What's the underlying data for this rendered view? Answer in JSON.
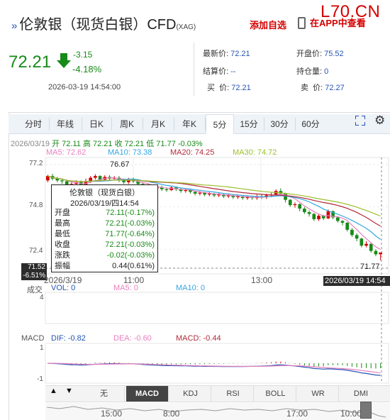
{
  "header": {
    "title": "伦敦银（现货白银）CFD",
    "title_sub": "(XAG)",
    "watermark": "L70.CN",
    "add_favorite": "添加自选",
    "app_link": "在APP中查看"
  },
  "quote": {
    "price": "72.21",
    "change": "-3.15",
    "change_pct": "-4.18%",
    "time": "2026-03-19 14:54:00",
    "stats": [
      {
        "label": "最新价:",
        "value": "72.21"
      },
      {
        "label": "开盘价:",
        "value": "75.52"
      },
      {
        "label": "结算价:",
        "value": "--"
      },
      {
        "label": "持仓量:",
        "value": "0"
      },
      {
        "label": "买  价:",
        "value": "72.21"
      },
      {
        "label": "卖  价:",
        "value": "72.27"
      }
    ]
  },
  "tabs": [
    "分时",
    "年线",
    "日K",
    "周K",
    "月K",
    "年K",
    "5分",
    "15分",
    "30分",
    "60分"
  ],
  "active_tab": "5分",
  "ohlc_line": {
    "date": "2026/03/19",
    "text": "开 72.11 高 72.21 收 72.21 低 71.77 -0.03%"
  },
  "ma": {
    "ma5": "MA5: 72.62",
    "ma10": "MA10: 73.38",
    "ma20": "MA20: 74.25",
    "ma30": "MA30: 74.72"
  },
  "colors": {
    "ma5": "#e87fbf",
    "ma10": "#35a7e0",
    "ma20": "#b02a3a",
    "ma30": "#9cbf2d",
    "down": "#188a18",
    "up": "#d40000"
  },
  "y_axis": [
    "77.2",
    "74.8",
    "72.4"
  ],
  "annotations": {
    "high": "76.67",
    "low": "71.77",
    "cross_price": "71.52",
    "cross_pct": "-6.51%",
    "cross_time": "2026/03/19 14:54"
  },
  "tooltip": {
    "title": "伦敦银（现货白银）",
    "datetime": "2026/03/19/四14:54",
    "rows": [
      {
        "label": "开盘",
        "value": "72.11(-0.17%)"
      },
      {
        "label": "最高",
        "value": "72.21(-0.03%)"
      },
      {
        "label": "最低",
        "value": "71.77(-0.64%)"
      },
      {
        "label": "收盘",
        "value": "72.21(-0.03%)"
      },
      {
        "label": "涨跌",
        "value": "-0.02(-0.03%)"
      },
      {
        "label": "振幅",
        "value": "0.44(0.61%)"
      }
    ]
  },
  "x_axis": [
    "2026/3/19",
    "11:00",
    "13:00"
  ],
  "volume": {
    "title": "成交",
    "vol": "VOL: 0",
    "ma5": "MA5: 0",
    "ma10": "MA10: 0",
    "y_max": "4"
  },
  "macd": {
    "title": "MACD",
    "dif": "DIF: -0.82",
    "dea": "DEA: -0.60",
    "macd": "MACD: -0.44",
    "y_top": "1",
    "y_bottom": "-1"
  },
  "indicator_buttons": [
    "无",
    "MACD",
    "KDJ",
    "RSI",
    "BOLL",
    "WR",
    "DMI"
  ],
  "active_indicator": "MACD",
  "nav_axis": [
    "15:00",
    "8:00",
    "17:00",
    "10:00"
  ],
  "chart_data": {
    "type": "candlestick",
    "interval": "5分",
    "ylim": [
      71.0,
      77.6
    ],
    "candles": [
      {
        "o": 76.3,
        "c": 76.55,
        "h": 76.62,
        "l": 76.2
      },
      {
        "o": 76.55,
        "c": 76.4,
        "h": 76.67,
        "l": 76.3
      },
      {
        "o": 76.4,
        "c": 76.3,
        "h": 76.5,
        "l": 76.2
      },
      {
        "o": 76.3,
        "c": 76.25,
        "h": 76.4,
        "l": 76.1
      },
      {
        "o": 76.25,
        "c": 76.0,
        "h": 76.35,
        "l": 75.95
      },
      {
        "o": 76.0,
        "c": 76.1,
        "h": 76.2,
        "l": 75.9
      },
      {
        "o": 76.1,
        "c": 76.2,
        "h": 76.3,
        "l": 76.0
      },
      {
        "o": 76.2,
        "c": 76.05,
        "h": 76.3,
        "l": 75.95
      },
      {
        "o": 76.05,
        "c": 76.25,
        "h": 76.4,
        "l": 76.0
      },
      {
        "o": 76.25,
        "c": 76.45,
        "h": 76.55,
        "l": 76.15
      },
      {
        "o": 76.45,
        "c": 76.55,
        "h": 76.65,
        "l": 76.35
      },
      {
        "o": 76.55,
        "c": 76.35,
        "h": 76.6,
        "l": 76.25
      },
      {
        "o": 76.35,
        "c": 76.5,
        "h": 76.6,
        "l": 76.25
      },
      {
        "o": 76.5,
        "c": 76.4,
        "h": 76.6,
        "l": 76.3
      },
      {
        "o": 76.4,
        "c": 76.45,
        "h": 76.55,
        "l": 76.3
      },
      {
        "o": 76.45,
        "c": 76.3,
        "h": 76.55,
        "l": 76.2
      },
      {
        "o": 76.3,
        "c": 76.2,
        "h": 76.4,
        "l": 76.1
      },
      {
        "o": 76.2,
        "c": 76.35,
        "h": 76.45,
        "l": 76.1
      },
      {
        "o": 76.35,
        "c": 76.25,
        "h": 76.45,
        "l": 76.15
      },
      {
        "o": 76.25,
        "c": 76.1,
        "h": 76.3,
        "l": 76.0
      },
      {
        "o": 76.1,
        "c": 75.95,
        "h": 76.2,
        "l": 75.85
      },
      {
        "o": 75.95,
        "c": 76.0,
        "h": 76.1,
        "l": 75.85
      },
      {
        "o": 76.0,
        "c": 75.85,
        "h": 76.05,
        "l": 75.75
      },
      {
        "o": 75.85,
        "c": 75.9,
        "h": 76.0,
        "l": 75.75
      },
      {
        "o": 75.9,
        "c": 75.8,
        "h": 76.0,
        "l": 75.7
      },
      {
        "o": 75.8,
        "c": 75.75,
        "h": 75.9,
        "l": 75.65
      },
      {
        "o": 75.75,
        "c": 75.9,
        "h": 76.0,
        "l": 75.7
      },
      {
        "o": 75.9,
        "c": 75.8,
        "h": 75.95,
        "l": 75.7
      },
      {
        "o": 75.8,
        "c": 75.7,
        "h": 75.85,
        "l": 75.6
      },
      {
        "o": 75.7,
        "c": 75.75,
        "h": 75.85,
        "l": 75.6
      },
      {
        "o": 75.75,
        "c": 75.65,
        "h": 75.8,
        "l": 75.55
      },
      {
        "o": 75.65,
        "c": 75.55,
        "h": 75.7,
        "l": 75.45
      },
      {
        "o": 75.55,
        "c": 75.6,
        "h": 75.7,
        "l": 75.45
      },
      {
        "o": 75.6,
        "c": 75.5,
        "h": 75.65,
        "l": 75.4
      },
      {
        "o": 75.5,
        "c": 75.55,
        "h": 75.65,
        "l": 75.4
      },
      {
        "o": 75.55,
        "c": 75.45,
        "h": 75.6,
        "l": 75.35
      },
      {
        "o": 75.45,
        "c": 75.5,
        "h": 75.6,
        "l": 75.35
      },
      {
        "o": 75.5,
        "c": 75.4,
        "h": 75.55,
        "l": 75.3
      },
      {
        "o": 75.4,
        "c": 75.45,
        "h": 75.55,
        "l": 75.3
      },
      {
        "o": 75.45,
        "c": 75.35,
        "h": 75.5,
        "l": 75.25
      },
      {
        "o": 75.35,
        "c": 75.4,
        "h": 75.5,
        "l": 75.25
      },
      {
        "o": 75.4,
        "c": 75.3,
        "h": 75.45,
        "l": 75.2
      },
      {
        "o": 75.3,
        "c": 75.35,
        "h": 75.45,
        "l": 75.2
      },
      {
        "o": 75.35,
        "c": 75.3,
        "h": 75.4,
        "l": 75.2
      },
      {
        "o": 75.3,
        "c": 75.4,
        "h": 75.5,
        "l": 75.2
      },
      {
        "o": 75.4,
        "c": 75.35,
        "h": 75.5,
        "l": 75.25
      },
      {
        "o": 75.35,
        "c": 75.45,
        "h": 75.55,
        "l": 75.25
      },
      {
        "o": 75.45,
        "c": 75.5,
        "h": 75.6,
        "l": 75.35
      },
      {
        "o": 75.5,
        "c": 75.7,
        "h": 75.8,
        "l": 75.4
      },
      {
        "o": 75.7,
        "c": 75.55,
        "h": 75.85,
        "l": 75.45
      },
      {
        "o": 75.55,
        "c": 75.2,
        "h": 75.6,
        "l": 75.05
      },
      {
        "o": 75.2,
        "c": 74.9,
        "h": 75.25,
        "l": 74.8
      },
      {
        "o": 74.9,
        "c": 74.95,
        "h": 75.05,
        "l": 74.75
      },
      {
        "o": 74.95,
        "c": 74.7,
        "h": 75.0,
        "l": 74.55
      },
      {
        "o": 74.7,
        "c": 74.5,
        "h": 74.8,
        "l": 74.4
      },
      {
        "o": 74.5,
        "c": 74.4,
        "h": 74.6,
        "l": 74.25
      },
      {
        "o": 74.4,
        "c": 74.1,
        "h": 74.45,
        "l": 74.0
      },
      {
        "o": 74.1,
        "c": 74.3,
        "h": 74.4,
        "l": 74.0
      },
      {
        "o": 74.3,
        "c": 74.15,
        "h": 74.35,
        "l": 74.05
      },
      {
        "o": 74.15,
        "c": 74.55,
        "h": 74.65,
        "l": 74.1
      },
      {
        "o": 74.55,
        "c": 74.2,
        "h": 74.6,
        "l": 74.1
      },
      {
        "o": 74.2,
        "c": 74.0,
        "h": 74.25,
        "l": 73.9
      },
      {
        "o": 74.0,
        "c": 73.9,
        "h": 74.05,
        "l": 73.75
      },
      {
        "o": 73.9,
        "c": 73.5,
        "h": 73.95,
        "l": 73.4
      },
      {
        "o": 73.5,
        "c": 73.2,
        "h": 73.6,
        "l": 73.1
      },
      {
        "o": 73.2,
        "c": 73.0,
        "h": 73.3,
        "l": 72.85
      },
      {
        "o": 73.0,
        "c": 72.6,
        "h": 73.05,
        "l": 72.5
      },
      {
        "o": 72.6,
        "c": 72.7,
        "h": 72.85,
        "l": 72.5
      },
      {
        "o": 72.7,
        "c": 72.3,
        "h": 72.75,
        "l": 72.2
      },
      {
        "o": 72.3,
        "c": 72.11,
        "h": 72.4,
        "l": 72.0
      },
      {
        "o": 72.11,
        "c": 72.21,
        "h": 72.21,
        "l": 71.77
      }
    ]
  }
}
